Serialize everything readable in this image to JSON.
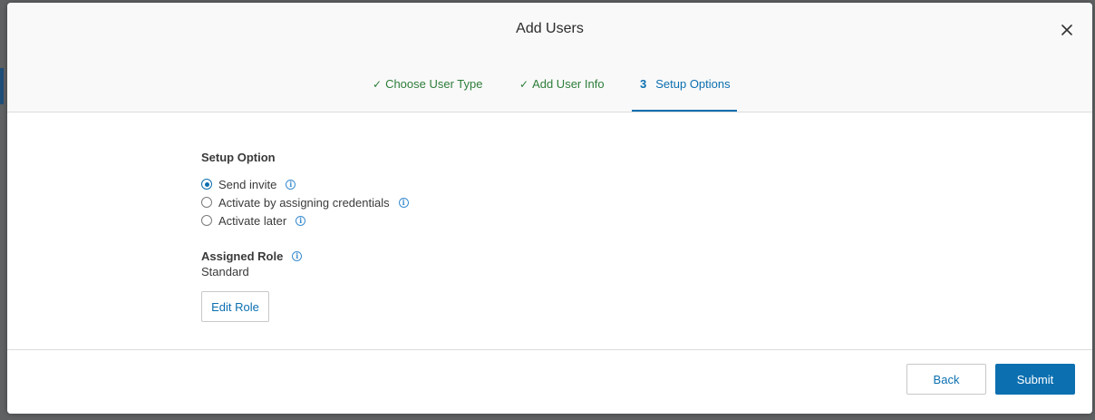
{
  "modal": {
    "title": "Add Users"
  },
  "steps": [
    {
      "check": "✓",
      "label": "Choose User Type",
      "state": "done"
    },
    {
      "check": "✓",
      "label": "Add User Info",
      "state": "done"
    },
    {
      "number": "3",
      "label": "Setup Options",
      "state": "active"
    }
  ],
  "setup": {
    "title": "Setup Option",
    "options": [
      {
        "label": "Send invite",
        "selected": true
      },
      {
        "label": "Activate by assigning credentials",
        "selected": false
      },
      {
        "label": "Activate later",
        "selected": false
      }
    ]
  },
  "role": {
    "title": "Assigned Role",
    "value": "Standard",
    "edit_label": "Edit Role"
  },
  "footer": {
    "back_label": "Back",
    "submit_label": "Submit"
  },
  "icons": {
    "info": "info-icon",
    "close": "close-icon",
    "check": "check-icon"
  },
  "colors": {
    "accent": "#0b6fb0",
    "done": "#2d7d3a"
  }
}
